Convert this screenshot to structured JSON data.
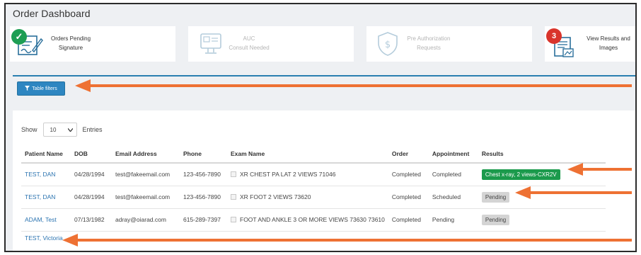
{
  "page": {
    "title": "Order Dashboard"
  },
  "cards": [
    {
      "line1": "Orders Pending",
      "line2": "Signature",
      "icon": "sign-document-icon",
      "badge": "✓"
    },
    {
      "line1": "AUC",
      "line2": "Consult Needed",
      "icon": "monitor-icon"
    },
    {
      "line1": "Pre Authorization",
      "line2": "Requests",
      "icon": "dollar-shield-icon"
    },
    {
      "line1": "View Results and",
      "line2": "Images",
      "icon": "results-document-icon",
      "badge": "3"
    }
  ],
  "filters": {
    "button_label": "Table filters",
    "icon": "filter-icon"
  },
  "table": {
    "show_label": "Show",
    "entries_value": "10",
    "entries_label": "Entries",
    "columns": [
      "Patient Name",
      "DOB",
      "Email Address",
      "Phone",
      "Exam Name",
      "Order",
      "Appointment",
      "Results"
    ],
    "rows": [
      {
        "patient": "TEST, DAN",
        "dob": "04/28/1994",
        "email": "test@fakeemail.com",
        "phone": "123-456-7890",
        "exam": "XR CHEST PA LAT 2 VIEWS 71046",
        "order": "Completed",
        "appointment": "Completed",
        "result": "Chest x-ray, 2 views-CXR2V"
      },
      {
        "patient": "TEST, DAN",
        "dob": "04/28/1994",
        "email": "test@fakeemail.com",
        "phone": "123-456-7890",
        "exam": "XR FOOT 2 VIEWS 73620",
        "order": "Completed",
        "appointment": "Scheduled",
        "result": "Pending"
      },
      {
        "patient": "ADAM, Test",
        "dob": "07/13/1982",
        "email": "adray@oiarad.com",
        "phone": "615-289-7397",
        "exam": "FOOT AND ANKLE 3 OR MORE VIEWS 73630 73610",
        "order": "Completed",
        "appointment": "Pending",
        "result": "Pending"
      },
      {
        "patient": "TEST, Victoria",
        "dob": "",
        "email": "",
        "phone": "",
        "exam": "",
        "order": "",
        "appointment": "",
        "result": ""
      }
    ]
  },
  "annotation_color": "#ee7133"
}
